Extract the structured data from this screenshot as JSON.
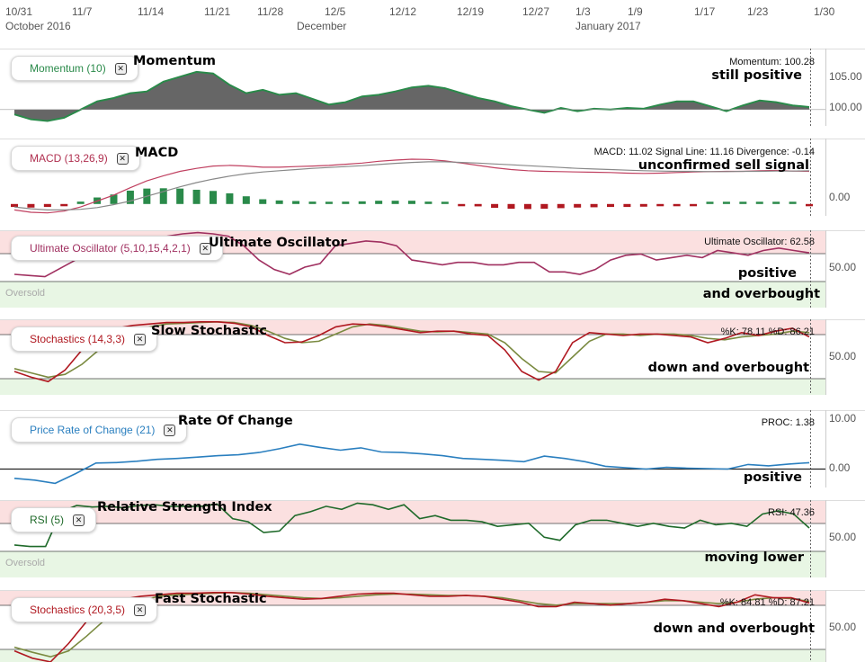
{
  "xaxis": {
    "dates": [
      "10/31",
      "11/7",
      "11/14",
      "11/21",
      "11/28",
      "12/5",
      "12/12",
      "12/19",
      "12/27",
      "1/3",
      "1/9",
      "1/17",
      "1/23",
      "1/30"
    ],
    "months": [
      "October 2016",
      "December",
      "January 2017"
    ]
  },
  "panels": {
    "momentum": {
      "chip": "Momentum (10)",
      "title": "Momentum",
      "readout": "Momentum: 100.28",
      "note1": "still positive",
      "note2": "",
      "yticks": [
        "105.00",
        "100.00"
      ]
    },
    "macd": {
      "chip": "MACD (13,26,9)",
      "title": "MACD",
      "readout": "MACD: 11.02 Signal Line: 11.16 Divergence: -0.14",
      "note1": "unconfirmed sell signal",
      "note2": "",
      "yticks": [
        "0.00"
      ]
    },
    "uo": {
      "chip": "Ultimate Oscillator (5,10,15,4,2,1)",
      "title": "Ultimate Oscillator",
      "readout": "Ultimate Oscillator: 62.58",
      "note1": "positive",
      "note2": "and overbought",
      "yticks": [
        "50.00"
      ],
      "zone": "Oversold"
    },
    "slowsto": {
      "chip": "Stochastics (14,3,3)",
      "title": "Slow Stochastic",
      "readout": "%K: 78.11 %D: 86.21",
      "note1": "down and overbought",
      "note2": "",
      "yticks": [
        "50.00"
      ]
    },
    "proc": {
      "chip": "Price Rate of Change (21)",
      "title": "Rate Of Change",
      "readout": "PROC: 1.38",
      "note1": "positive",
      "note2": "",
      "yticks": [
        "10.00",
        "0.00"
      ]
    },
    "rsi": {
      "chip": "RSI (5)",
      "title": "Relative Strength Index",
      "readout": "RSI: 47.36",
      "note1": "moving lower",
      "note2": "",
      "yticks": [
        "50.00"
      ],
      "zone": "Oversold"
    },
    "faststo": {
      "chip": "Stochastics (20,3,5)",
      "title": "Fast Stochastic",
      "readout": "%K: 84.81 %D: 87.21",
      "note1": "down and overbought",
      "note2": "",
      "yticks": [
        "50.00"
      ]
    }
  },
  "colors": {
    "green": "#2a8a4a",
    "red": "#b01820",
    "maroon": "#a03060",
    "blue": "#2a7fbf",
    "olive": "#7a8a40",
    "darkgreen": "#1f6a2a",
    "grey": "#666666"
  },
  "chart_data": [
    {
      "type": "area",
      "name": "Momentum (10)",
      "baseline": 100,
      "ylim": [
        98,
        107
      ],
      "values": [
        99.4,
        98.8,
        98.6,
        99.0,
        100.0,
        101.0,
        101.4,
        102.0,
        102.2,
        103.4,
        104.0,
        104.6,
        104.4,
        103.0,
        102.0,
        102.4,
        101.8,
        102.0,
        101.3,
        100.6,
        100.9,
        101.6,
        101.8,
        102.2,
        102.7,
        102.9,
        102.6,
        102.0,
        101.4,
        101.0,
        100.4,
        100.0,
        99.6,
        100.2,
        99.8,
        100.1,
        100.0,
        100.2,
        100.1,
        100.6,
        101.0,
        101.0,
        100.4,
        99.8,
        100.5,
        101.1,
        100.9,
        100.5,
        100.3
      ]
    },
    {
      "type": "line",
      "name": "MACD (13,26,9)",
      "ylim": [
        -4,
        16
      ],
      "series": [
        {
          "name": "MACD",
          "values": [
            -2.0,
            -2.8,
            -3.0,
            -2.4,
            -1.0,
            1.0,
            3.0,
            5.5,
            7.8,
            9.5,
            11.0,
            12.0,
            12.8,
            13.0,
            12.8,
            12.4,
            12.4,
            12.6,
            12.8,
            13.0,
            13.4,
            13.8,
            14.4,
            14.8,
            15.1,
            15.0,
            14.5,
            13.8,
            13.0,
            12.2,
            11.6,
            11.2,
            11.0,
            10.9,
            10.8,
            10.7,
            10.6,
            10.4,
            10.3,
            10.4,
            10.6,
            10.8,
            10.9,
            11.0,
            11.0,
            11.2,
            11.3,
            11.1,
            11.0
          ]
        },
        {
          "name": "Signal Line",
          "values": [
            -1.0,
            -1.6,
            -2.0,
            -2.0,
            -1.8,
            -1.2,
            -0.2,
            1.0,
            2.6,
            4.2,
            5.8,
            7.2,
            8.4,
            9.4,
            10.2,
            10.8,
            11.2,
            11.6,
            12.0,
            12.3,
            12.6,
            12.9,
            13.3,
            13.7,
            14.0,
            14.2,
            14.2,
            14.0,
            13.8,
            13.5,
            13.2,
            12.9,
            12.6,
            12.3,
            12.0,
            11.8,
            11.6,
            11.4,
            11.2,
            11.1,
            11.0,
            11.0,
            10.9,
            10.9,
            11.0,
            11.0,
            11.1,
            11.1,
            11.2
          ]
        },
        {
          "name": "Divergence",
          "values": [
            -1.0,
            -1.2,
            -1.0,
            -0.4,
            0.8,
            2.2,
            3.2,
            4.5,
            5.2,
            5.3,
            5.2,
            4.8,
            4.4,
            3.6,
            2.6,
            1.6,
            1.2,
            1.0,
            0.8,
            0.7,
            0.8,
            0.9,
            1.1,
            1.1,
            1.1,
            0.8,
            0.3,
            -0.2,
            -0.8,
            -1.3,
            -1.6,
            -1.7,
            -1.6,
            -1.4,
            -1.2,
            -1.1,
            -1.0,
            -1.0,
            -0.9,
            -0.7,
            -0.4,
            -0.2,
            0.0,
            0.1,
            0.0,
            0.2,
            0.2,
            0.0,
            -0.14
          ]
        }
      ]
    },
    {
      "type": "line",
      "name": "Ultimate Oscillator (5,10,15,4,2,1)",
      "ylim": [
        30,
        95
      ],
      "values": [
        58,
        57,
        56,
        63,
        70,
        73,
        76,
        78,
        82,
        86,
        90,
        92,
        93,
        92,
        90,
        82,
        70,
        62,
        58,
        64,
        67,
        82,
        84,
        86,
        85,
        82,
        70,
        68,
        66,
        68,
        68,
        66,
        66,
        68,
        68,
        60,
        60,
        58,
        62,
        70,
        74,
        75,
        70,
        72,
        74,
        72,
        78,
        76,
        74,
        78,
        80,
        78,
        76
      ]
    },
    {
      "type": "line",
      "name": "Stochastics (14,3,3)",
      "ylim": [
        0,
        100
      ],
      "series": [
        {
          "name": "%K",
          "values": [
            30,
            22,
            16,
            32,
            60,
            82,
            90,
            94,
            96,
            98,
            98,
            99,
            99,
            97,
            92,
            80,
            70,
            71,
            80,
            92,
            96,
            95,
            92,
            88,
            84,
            86,
            86,
            82,
            80,
            60,
            30,
            18,
            30,
            70,
            84,
            82,
            80,
            82,
            82,
            80,
            78,
            70,
            76,
            84,
            80,
            86,
            90,
            78
          ]
        },
        {
          "name": "%D",
          "values": [
            34,
            28,
            22,
            26,
            40,
            60,
            76,
            86,
            92,
            96,
            97,
            98,
            99,
            98,
            94,
            86,
            76,
            70,
            72,
            82,
            92,
            96,
            94,
            90,
            86,
            85,
            86,
            84,
            82,
            70,
            48,
            30,
            28,
            50,
            72,
            82,
            82,
            80,
            82,
            82,
            80,
            76,
            74,
            78,
            80,
            82,
            86,
            84
          ]
        }
      ]
    },
    {
      "type": "line",
      "name": "Price Rate of Change (21)",
      "ylim": [
        -4,
        12
      ],
      "values": [
        -2.0,
        -2.4,
        -3.1,
        -1.0,
        1.3,
        1.4,
        1.7,
        2.1,
        2.3,
        2.6,
        2.9,
        3.1,
        3.6,
        4.4,
        5.4,
        4.7,
        4.1,
        4.6,
        3.7,
        3.6,
        3.3,
        2.9,
        2.3,
        2.1,
        1.9,
        1.6,
        2.8,
        2.3,
        1.6,
        0.6,
        0.3,
        0.0,
        0.4,
        0.2,
        0.1,
        0.0,
        1.0,
        0.7,
        1.1,
        1.38
      ]
    },
    {
      "type": "line",
      "name": "RSI (5)",
      "ylim": [
        0,
        100
      ],
      "values": [
        42,
        40,
        40,
        85,
        93,
        91,
        92,
        90,
        93,
        94,
        92,
        92,
        92,
        95,
        76,
        72,
        58,
        60,
        80,
        85,
        92,
        88,
        96,
        94,
        88,
        94,
        76,
        80,
        74,
        74,
        72,
        66,
        68,
        70,
        52,
        48,
        68,
        74,
        74,
        70,
        66,
        70,
        66,
        64,
        74,
        68,
        70,
        66,
        82,
        86,
        82,
        64
      ]
    },
    {
      "type": "line",
      "name": "Stochastics (20,3,5)",
      "ylim": [
        0,
        100
      ],
      "series": [
        {
          "name": "%K",
          "values": [
            20,
            10,
            5,
            30,
            60,
            82,
            90,
            94,
            96,
            98,
            98,
            99,
            99,
            97,
            94,
            92,
            90,
            91,
            94,
            97,
            98,
            98,
            96,
            94,
            94,
            95,
            94,
            90,
            86,
            80,
            80,
            86,
            84,
            82,
            84,
            86,
            90,
            88,
            84,
            80,
            86,
            96,
            92,
            92,
            85
          ]
        },
        {
          "name": "%D",
          "values": [
            25,
            18,
            12,
            20,
            40,
            62,
            80,
            88,
            94,
            96,
            97,
            98,
            99,
            98,
            96,
            94,
            92,
            91,
            92,
            94,
            96,
            97,
            97,
            96,
            95,
            95,
            94,
            92,
            88,
            84,
            82,
            84,
            84,
            84,
            84,
            86,
            88,
            88,
            86,
            84,
            86,
            90,
            92,
            91,
            87
          ]
        }
      ]
    }
  ]
}
